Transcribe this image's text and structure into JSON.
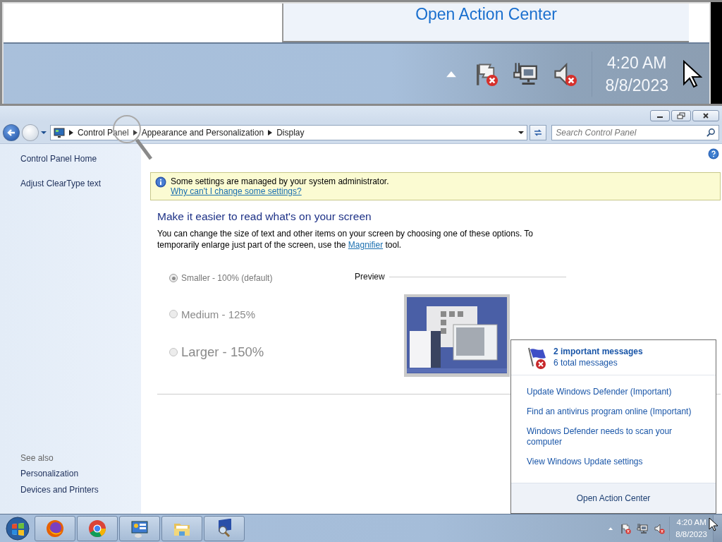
{
  "magnifier_view": {
    "link": "Open Action Center",
    "time": "4:20 AM",
    "date": "8/8/2023"
  },
  "window": {
    "breadcrumb": [
      "Control Panel",
      "Appearance and Personalization",
      "Display"
    ],
    "search": {
      "placeholder": "Search Control Panel"
    }
  },
  "sidebar": {
    "items": [
      "Control Panel Home",
      "Adjust ClearType text"
    ],
    "see_also_heading": "See also",
    "see_also": [
      "Personalization",
      "Devices and Printers"
    ]
  },
  "notice": {
    "text": "Some settings are managed by your system administrator.",
    "link": "Why can't I change some settings?"
  },
  "heading": "Make it easier to read what's on your screen",
  "description": {
    "before": "You can change the size of text and other items on your screen by choosing one of these options. To temporarily enlarge just part of the screen, use the ",
    "link": "Magnifier",
    "after": " tool."
  },
  "options": [
    {
      "label": "Smaller - 100% (default)",
      "kind": "small",
      "selected": true,
      "disabled": true
    },
    {
      "label": "Medium - 125%",
      "kind": "medium",
      "selected": false,
      "disabled": true
    },
    {
      "label": "Larger - 150%",
      "kind": "large",
      "selected": false,
      "disabled": true
    }
  ],
  "preview": {
    "label": "Preview"
  },
  "action_center": {
    "title": "2 important messages",
    "subtitle": "6 total messages",
    "messages": [
      "Update Windows Defender (Important)",
      "Find an antivirus program online (Important)",
      "Windows Defender needs to scan your computer",
      "View Windows Update settings"
    ],
    "footer": "Open Action Center"
  },
  "taskbar": {
    "time": "4:20 AM",
    "date": "8/8/2023"
  }
}
